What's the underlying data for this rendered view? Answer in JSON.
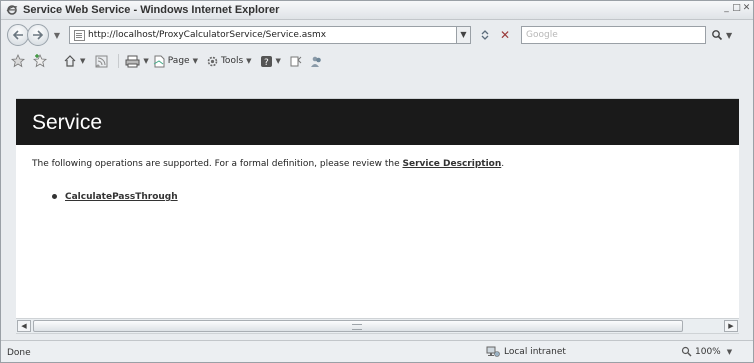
{
  "window": {
    "title": "Service Web Service - Windows Internet Explorer",
    "controls": [
      "minimize",
      "restore",
      "close"
    ]
  },
  "address_bar": {
    "url": "http://localhost/ProxyCalculatorService/Service.asmx",
    "search_placeholder": "Google"
  },
  "command_bar": {
    "page_label": "Page",
    "tools_label": "Tools"
  },
  "page": {
    "heading": "Service",
    "intro_text": "The following operations are supported. For a formal definition, please review the ",
    "service_description_link": "Service Description",
    "intro_end": ".",
    "operations": [
      {
        "label": "CalculatePassThrough"
      }
    ]
  },
  "status_bar": {
    "status": "Done",
    "zone": "Local intranet",
    "zoom": "100%"
  },
  "colors": {
    "banner_bg": "#1a1a1a",
    "banner_text": "#ffffff",
    "chrome_bg": "#e9ecef"
  }
}
